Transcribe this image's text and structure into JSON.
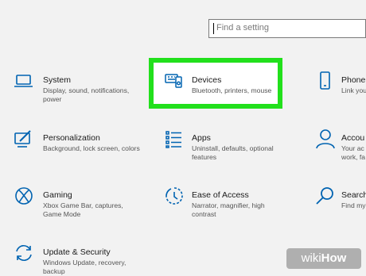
{
  "search": {
    "placeholder": "Find a setting"
  },
  "tiles": {
    "system": {
      "title": "System",
      "desc": "Display, sound, notifications, power"
    },
    "devices": {
      "title": "Devices",
      "desc": "Bluetooth, printers, mouse"
    },
    "phone": {
      "title": "Phone",
      "desc": "Link you"
    },
    "personalization": {
      "title": "Personalization",
      "desc": "Background, lock screen, colors"
    },
    "apps": {
      "title": "Apps",
      "desc": "Uninstall, defaults, optional features"
    },
    "accounts": {
      "title": "Accou",
      "desc": "Your ac work, fa"
    },
    "gaming": {
      "title": "Gaming",
      "desc": "Xbox Game Bar, captures, Game Mode"
    },
    "ease": {
      "title": "Ease of Access",
      "desc": "Narrator, magnifier, high contrast"
    },
    "search": {
      "title": "Search",
      "desc": "Find my"
    },
    "update": {
      "title": "Update & Security",
      "desc": "Windows Update, recovery, backup"
    }
  },
  "watermark": {
    "prefix": "wiki",
    "suffix": "How"
  },
  "colors": {
    "accent": "#0063b1",
    "highlight": "#22e01c",
    "background": "#f2f2f2"
  },
  "icons": [
    "laptop-icon",
    "devices-icon",
    "phone-icon",
    "personalization-icon",
    "apps-icon",
    "account-icon",
    "xbox-icon",
    "ease-of-access-icon",
    "search-icon",
    "update-icon"
  ]
}
